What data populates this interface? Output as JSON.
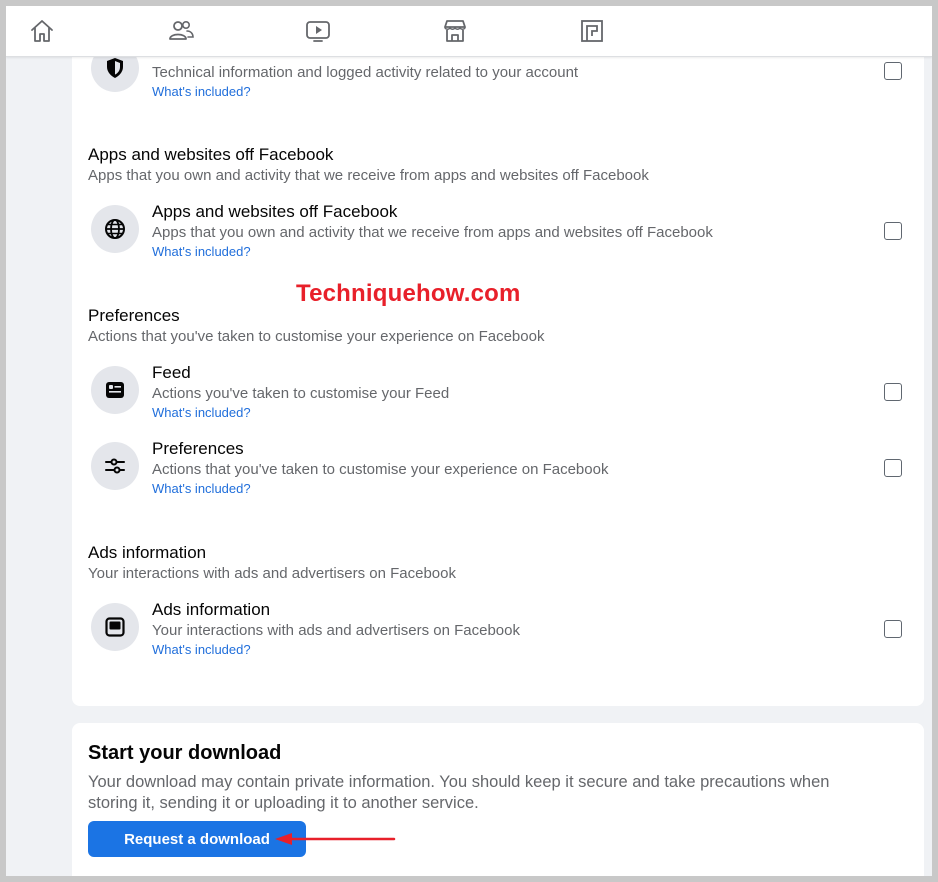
{
  "nav": {
    "icons": [
      "home-icon",
      "friends-icon",
      "watch-icon",
      "marketplace-icon",
      "gaming-icon"
    ]
  },
  "partial_item": {
    "desc": "Technical information and logged activity related to your account",
    "link": "What's included?",
    "icon": "shield-icon"
  },
  "sections": [
    {
      "title": "Apps and websites off Facebook",
      "subtitle": "Apps that you own and activity that we receive from apps and websites off Facebook",
      "items": [
        {
          "title": "Apps and websites off Facebook",
          "desc": "Apps that you own and activity that we receive from apps and websites off Facebook",
          "link": "What's included?",
          "icon": "globe-icon"
        }
      ]
    },
    {
      "title": "Preferences",
      "subtitle": "Actions that you've taken to customise your experience on Facebook",
      "items": [
        {
          "title": "Feed",
          "desc": "Actions you've taken to customise your Feed",
          "link": "What's included?",
          "icon": "feed-icon"
        },
        {
          "title": "Preferences",
          "desc": "Actions that you've taken to customise your experience on Facebook",
          "link": "What's included?",
          "icon": "sliders-icon"
        }
      ]
    },
    {
      "title": "Ads information",
      "subtitle": "Your interactions with ads and advertisers on Facebook",
      "items": [
        {
          "title": "Ads information",
          "desc": "Your interactions with ads and advertisers on Facebook",
          "link": "What's included?",
          "icon": "ads-icon"
        }
      ]
    }
  ],
  "watermark": "Techniquehow.com",
  "download": {
    "title": "Start your download",
    "desc": "Your download may contain private information. You should keep it secure and take precautions when storing it, sending it or uploading it to another service.",
    "button_label": "Request a download"
  },
  "colors": {
    "accent": "#1b74e4",
    "link": "#216fdb",
    "watermark": "#e8202a",
    "arrow": "#e8202a"
  }
}
